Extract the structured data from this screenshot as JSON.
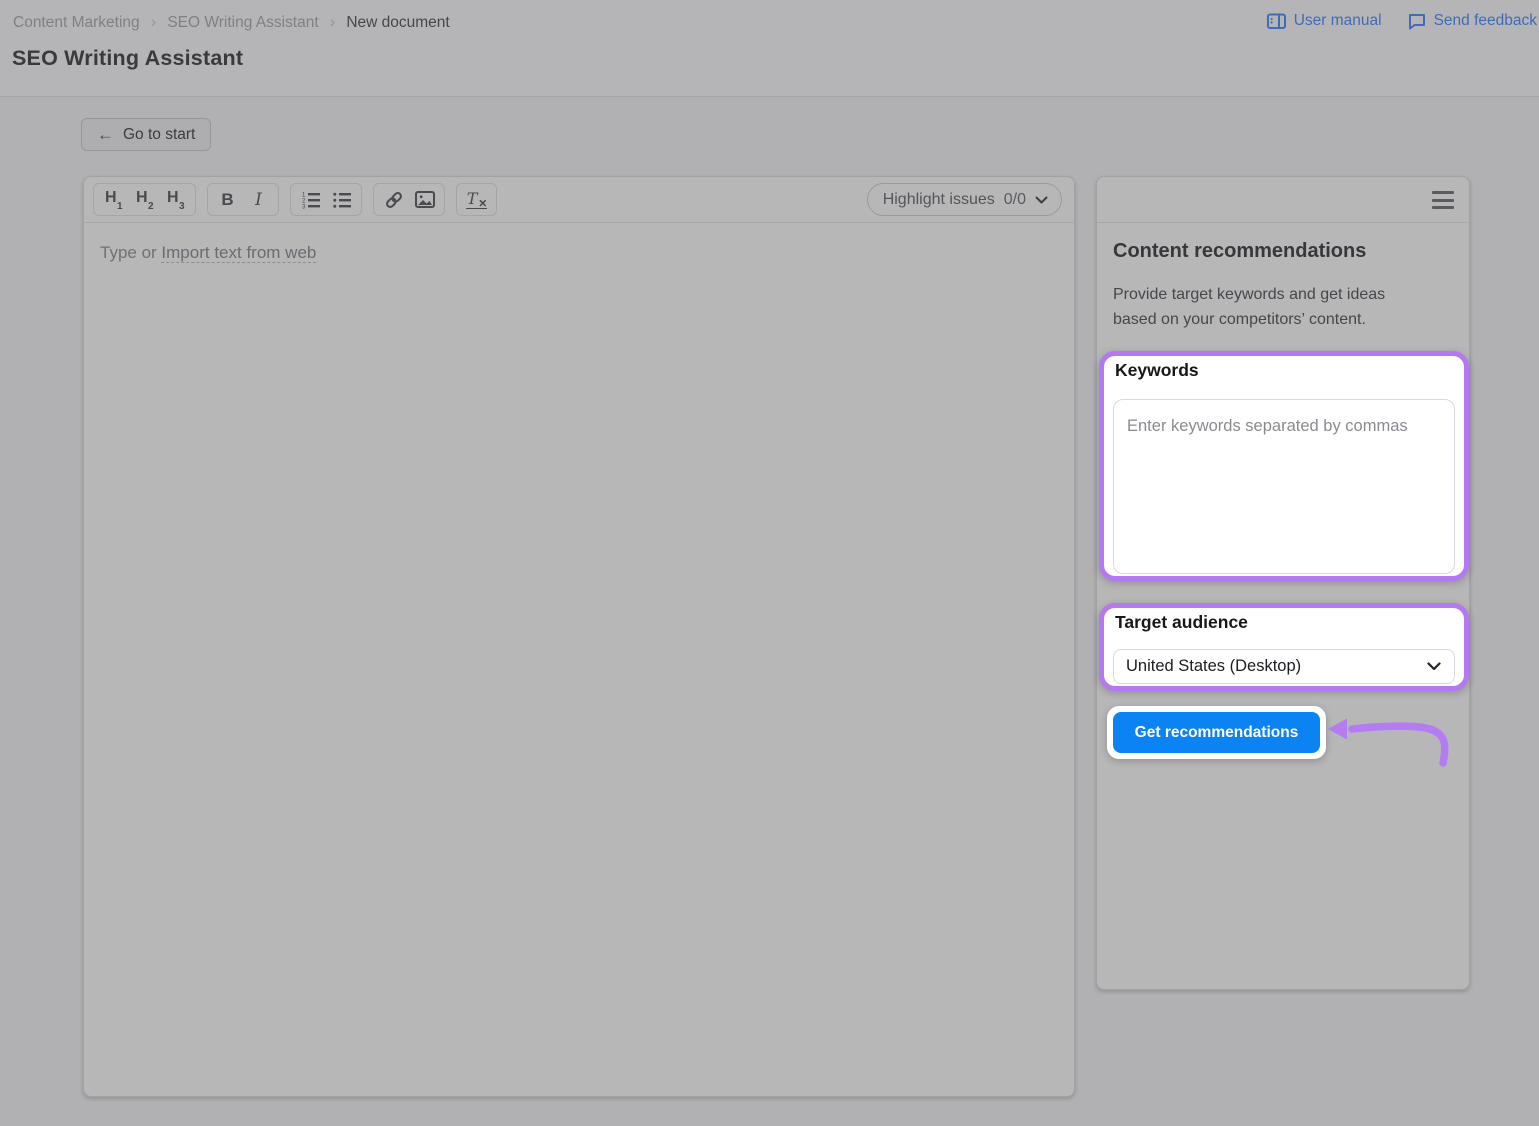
{
  "breadcrumb": {
    "separator": "›",
    "items": [
      {
        "label": "Content Marketing"
      },
      {
        "label": "SEO Writing Assistant"
      },
      {
        "label": "New document"
      }
    ]
  },
  "header": {
    "title": "SEO Writing Assistant",
    "user_manual_label": "User manual",
    "send_feedback_label": "Send feedback"
  },
  "actions": {
    "go_to_start_label": "Go to start"
  },
  "icons": {
    "back_arrow": "←"
  },
  "editor": {
    "toolbar": {
      "headings": [
        {
          "letter": "H",
          "num": "1"
        },
        {
          "letter": "H",
          "num": "2"
        },
        {
          "letter": "H",
          "num": "3"
        }
      ],
      "bold_label": "B",
      "italic_label": "I",
      "clear_formatting_letter": "T",
      "clear_formatting_x": "✕",
      "highlight_issues": {
        "label": "Highlight issues",
        "count": "0/0"
      }
    },
    "placeholder": {
      "prefix": "Type or ",
      "link": "Import text from web"
    }
  },
  "panel": {
    "title": "Content recommendations",
    "description": "Provide target keywords and get ideas based on your competitors’ content.",
    "keywords": {
      "label": "Keywords",
      "placeholder": "Enter keywords separated by commas"
    },
    "target_audience": {
      "label": "Target audience",
      "selected_option": "United States (Desktop)"
    },
    "get_recommendations_label": "Get recommendations"
  },
  "colors": {
    "highlight_purple": "#b478f0",
    "arrow_purple": "#b57bf3",
    "primary_blue": "#0c83f2",
    "link_blue": "#3f6cb5",
    "dim_background": "#b1b1b3"
  }
}
